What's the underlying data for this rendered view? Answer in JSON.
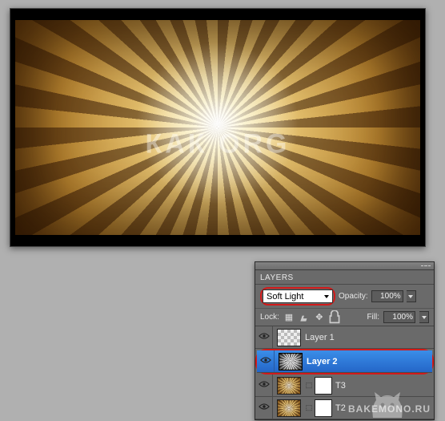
{
  "canvas": {
    "watermark": "КАК          ORG"
  },
  "panel": {
    "title": "LAYERS",
    "blend_mode": "Soft Light",
    "opacity_label": "Opacity:",
    "opacity_value": "100%",
    "lock_label": "Lock:",
    "fill_label": "Fill:",
    "fill_value": "100%",
    "layers": [
      {
        "name": "Layer 1"
      },
      {
        "name": "Layer 2"
      },
      {
        "name": "T3"
      },
      {
        "name": "T2"
      }
    ]
  },
  "footer_watermark": "BAKEMONO.RU"
}
